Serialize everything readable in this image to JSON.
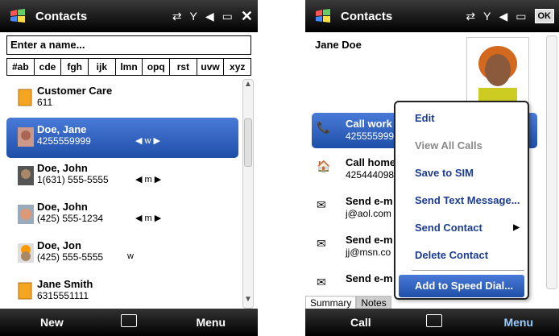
{
  "left": {
    "title": "Contacts",
    "search_placeholder": "Enter a name...",
    "tabs": [
      "#ab",
      "cde",
      "fgh",
      "ijk",
      "lmn",
      "opq",
      "rst",
      "uvw",
      "xyz"
    ],
    "rows": [
      {
        "name": "Customer Care",
        "num": "611",
        "arrows": ""
      },
      {
        "name": "Doe, Jane",
        "num": "4255559999",
        "arrows": "◀ w ▶"
      },
      {
        "name": "Doe, John",
        "num": "1(631) 555-5555",
        "arrows": "◀ m ▶"
      },
      {
        "name": "Doe, John",
        "num": "(425) 555-1234",
        "arrows": "◀ m ▶"
      },
      {
        "name": "Doe, Jon",
        "num": "(425) 555-5555",
        "arrows": "w"
      },
      {
        "name": "Jane Smith",
        "num": "6315551111",
        "arrows": ""
      }
    ],
    "bottom": {
      "left": "New",
      "right": "Menu"
    }
  },
  "right": {
    "title": "Contacts",
    "ok": "OK",
    "contact_name": "Jane Doe",
    "details": [
      {
        "line1": "Call work",
        "line2": "425555999"
      },
      {
        "line1": "Call home",
        "line2": "425444098"
      },
      {
        "line1": "Send e-m",
        "line2": "j@aol.com"
      },
      {
        "line1": "Send e-m",
        "line2": "jj@msn.co"
      },
      {
        "line1": "Send e-m",
        "line2": ""
      }
    ],
    "menu": [
      {
        "label": "Edit"
      },
      {
        "label": "View All Calls"
      },
      {
        "label": "Save to SIM"
      },
      {
        "label": "Send Text Message..."
      },
      {
        "label": "Send Contact"
      },
      {
        "label": "Delete Contact"
      },
      {
        "label": "Add to Speed Dial..."
      }
    ],
    "summary_tabs": [
      "Summary",
      "Notes"
    ],
    "bottom": {
      "left": "Call",
      "right": "Menu"
    }
  }
}
